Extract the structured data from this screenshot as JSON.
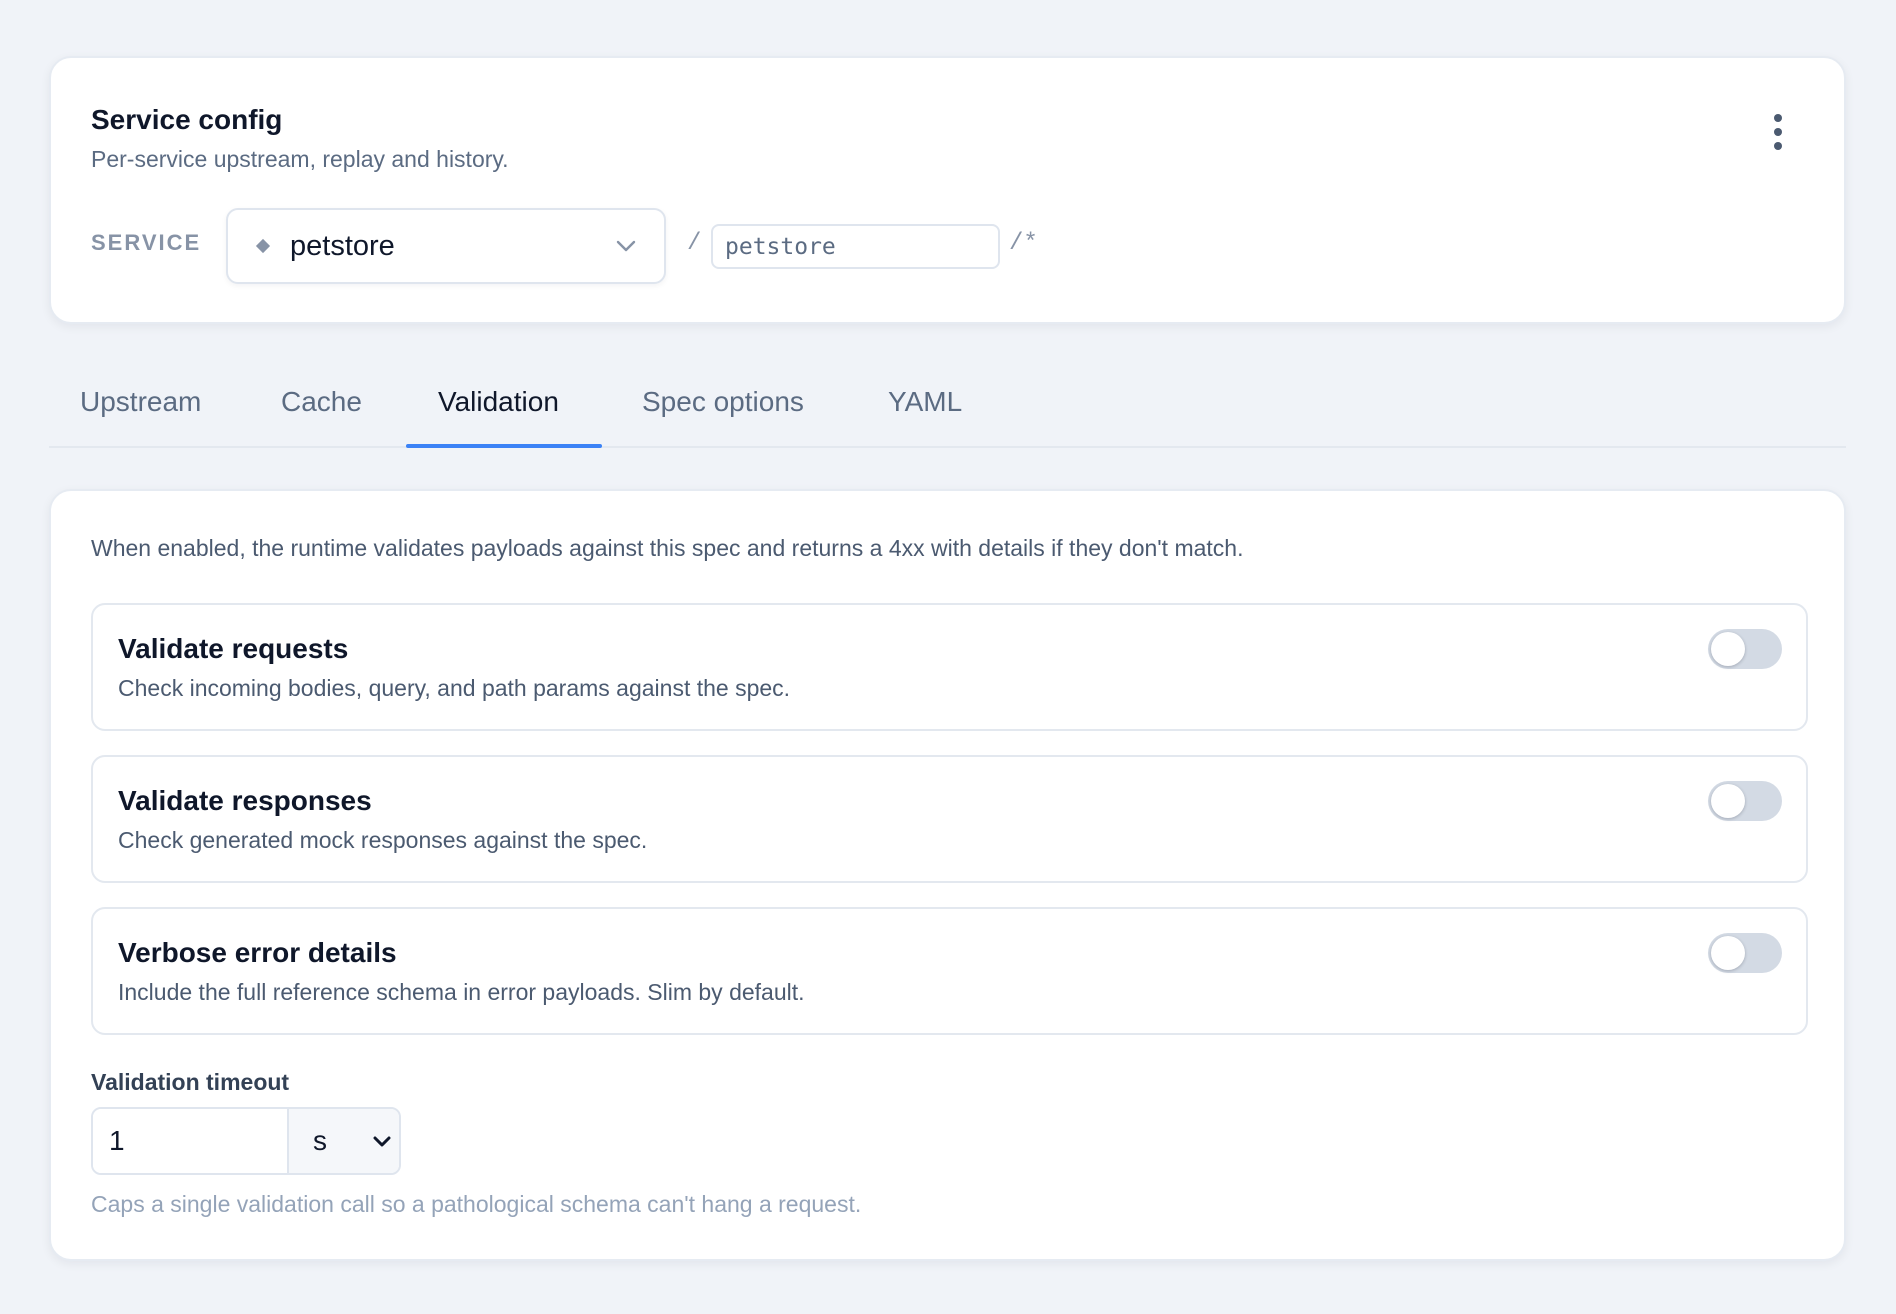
{
  "header": {
    "title": "Service config",
    "subtitle": "Per-service upstream, replay and history.",
    "menu_icon": "kebab-vertical-icon"
  },
  "service": {
    "label": "SERVICE",
    "selected": "petstore",
    "selector_icon": "diamond-icon",
    "slash": "/",
    "prefix_value": "petstore",
    "suffix": "/*"
  },
  "tabs": [
    {
      "label": "Upstream",
      "active": false
    },
    {
      "label": "Cache",
      "active": false
    },
    {
      "label": "Validation",
      "active": true
    },
    {
      "label": "Spec options",
      "active": false
    },
    {
      "label": "YAML",
      "active": false
    }
  ],
  "validation": {
    "intro": "When enabled, the runtime validates payloads against this spec and returns a 4xx with details if they don't match.",
    "options": [
      {
        "title": "Validate requests",
        "description": "Check incoming bodies, query, and path params against the spec.",
        "enabled": false
      },
      {
        "title": "Validate responses",
        "description": "Check generated mock responses against the spec.",
        "enabled": false
      },
      {
        "title": "Verbose error details",
        "description": "Include the full reference schema in error payloads. Slim by default.",
        "enabled": false
      }
    ],
    "timeout": {
      "label": "Validation timeout",
      "value": "1",
      "unit": "s",
      "help": "Caps a single validation call so a pathological schema can't hang a request."
    }
  },
  "colors": {
    "accent": "#3b82f6",
    "background": "#f0f3f8",
    "toggle_off": "#d3dae4"
  }
}
